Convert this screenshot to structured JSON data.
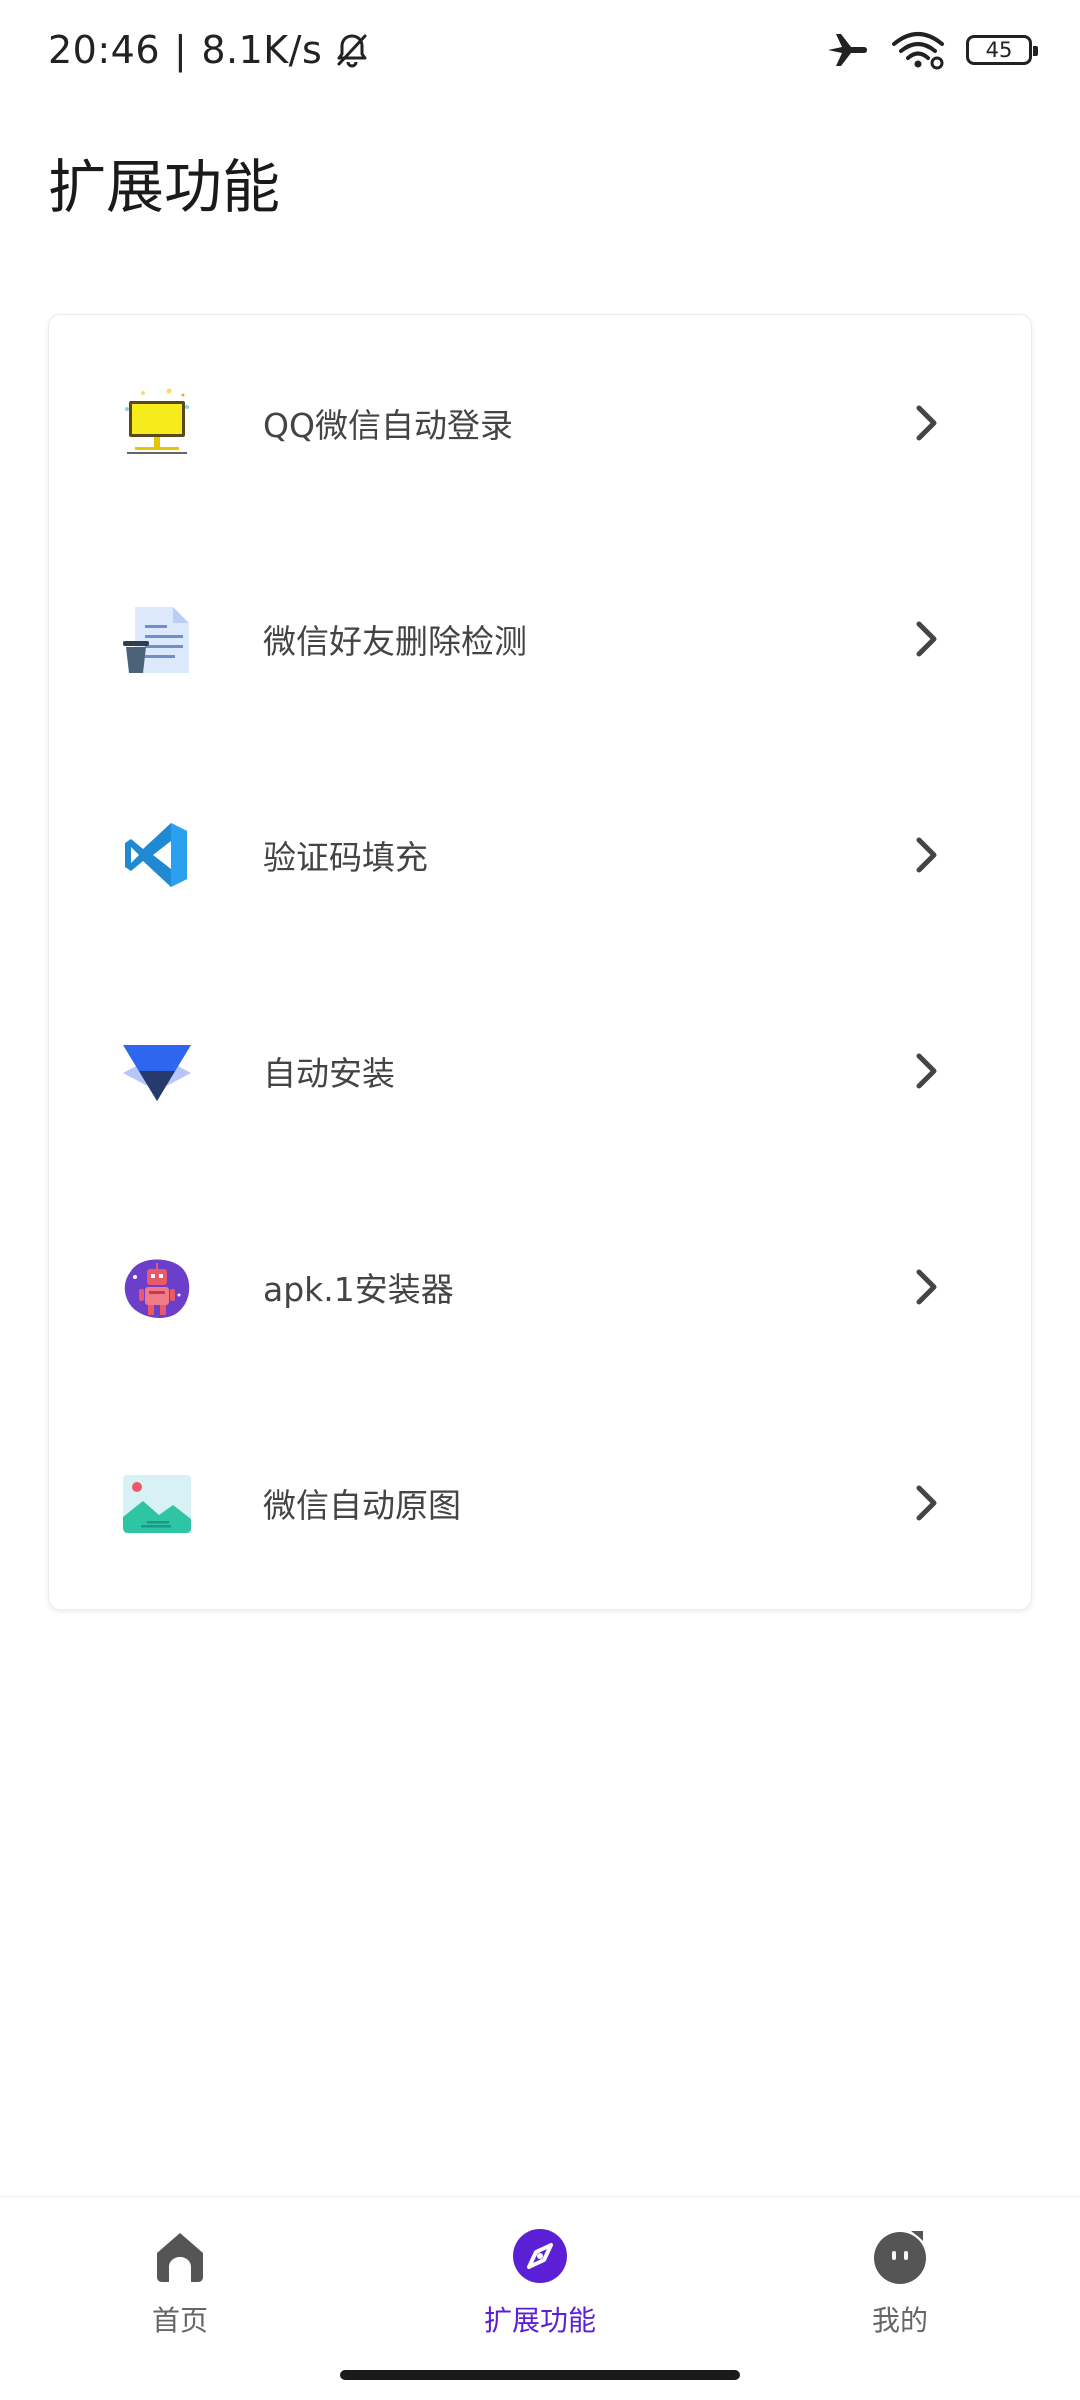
{
  "status_bar": {
    "time": "20:46",
    "separator": "|",
    "speed": "8.1K/s",
    "battery": "45",
    "icons": [
      "bell-muted-icon",
      "airplane-icon",
      "wifi-icon",
      "battery-icon"
    ]
  },
  "page": {
    "title": "扩展功能"
  },
  "features": [
    {
      "label": "QQ微信自动登录",
      "icon": "monitor-icon"
    },
    {
      "label": "微信好友删除检测",
      "icon": "document-trash-icon"
    },
    {
      "label": "验证码填充",
      "icon": "vscode-logo-icon"
    },
    {
      "label": "自动安装",
      "icon": "triangle-install-icon"
    },
    {
      "label": "apk.1安装器",
      "icon": "robot-icon"
    },
    {
      "label": "微信自动原图",
      "icon": "image-icon"
    }
  ],
  "bottom_nav": {
    "items": [
      {
        "label": "首页",
        "icon": "home-icon",
        "active": false
      },
      {
        "label": "扩展功能",
        "icon": "compass-icon",
        "active": true
      },
      {
        "label": "我的",
        "icon": "profile-face-icon",
        "active": false
      }
    ]
  },
  "colors": {
    "accent": "#5b1fd6",
    "text": "#444444",
    "nav_inactive": "#555555"
  }
}
